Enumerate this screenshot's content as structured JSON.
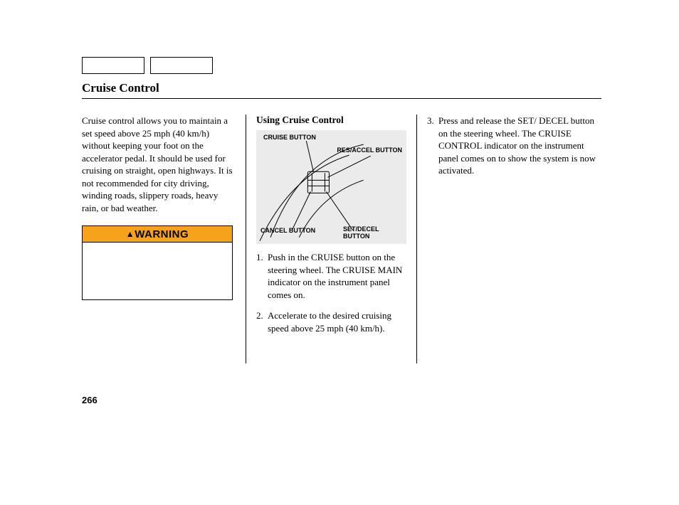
{
  "title": "Cruise Control",
  "intro": "Cruise control allows you to maintain a set speed above 25 mph (40 km/h) without keeping your foot on the accelerator pedal. It should be used for cruising on straight, open highways. It is not recommended for city driving, winding roads, slippery roads, heavy rain, or bad weather.",
  "warning": {
    "label": "WARNING"
  },
  "subhead": "Using Cruise Control",
  "diagram": {
    "cruise": "CRUISE BUTTON",
    "res": "RES/ACCEL BUTTON",
    "cancel": "CANCEL BUTTON",
    "set": "SET/DECEL BUTTON"
  },
  "steps": {
    "s1": "Push in the CRUISE button on the steering wheel. The CRUISE MAIN indicator on the instrument panel comes on.",
    "s2": "Accelerate to the desired cruising speed above 25 mph (40 km/h).",
    "s3": "Press and release the SET/ DECEL button on the steering wheel. The CRUISE CONTROL indicator on the instrument panel comes on to show the system is now activated."
  },
  "page_number": "266"
}
